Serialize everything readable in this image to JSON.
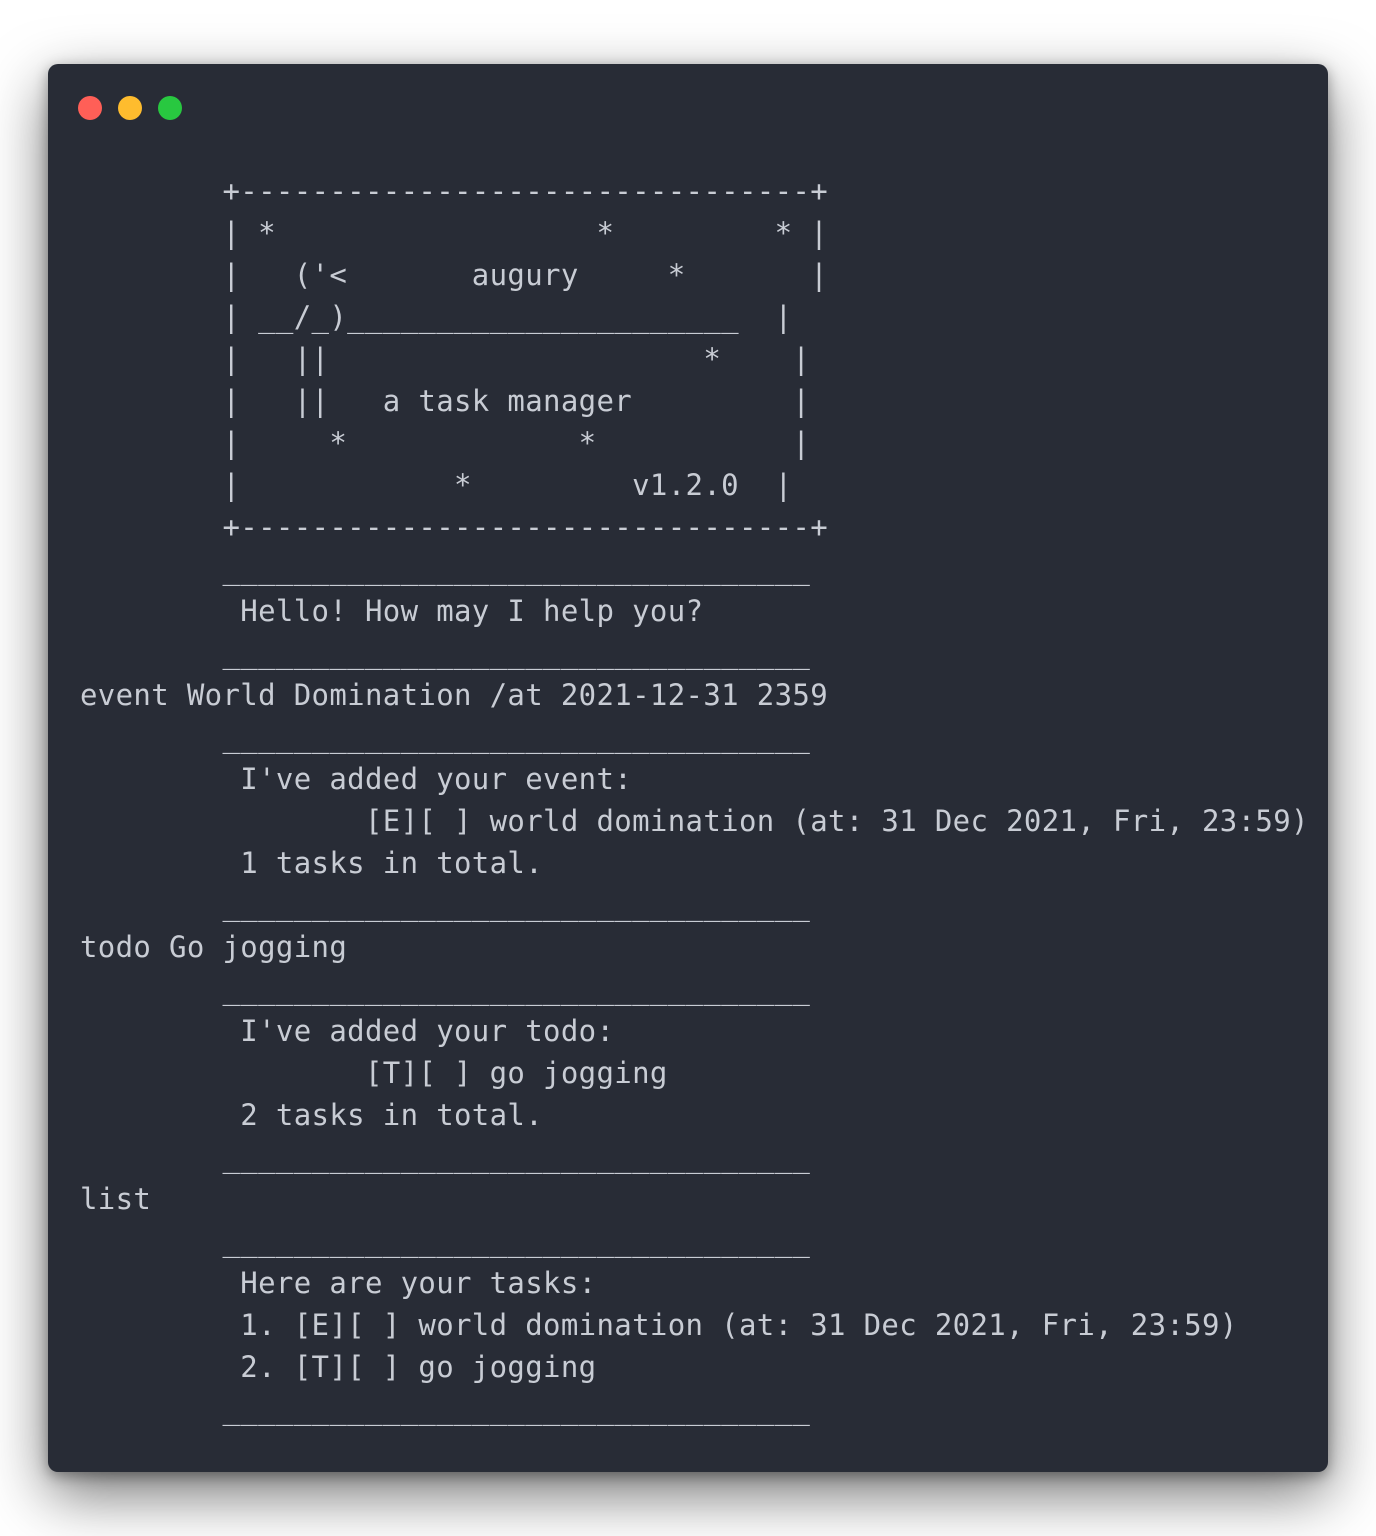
{
  "window": {
    "controls": [
      {
        "name": "close",
        "color": "#ff5f57"
      },
      {
        "name": "minimize",
        "color": "#febc2e"
      },
      {
        "name": "zoom",
        "color": "#28c840"
      }
    ]
  },
  "terminal": {
    "text_color": "#c8ccd4",
    "background": "#282c36",
    "lines": [
      "        +--------------------------------+",
      "        | *                  *         * |",
      "        |   ('<       augury     *       |",
      "        | __/_)______________________  |",
      "        |   ||                     *    |",
      "        |   ||   a task manager         |",
      "        |     *             *           |",
      "        |            *         v1.2.0  |",
      "        +--------------------------------+",
      "        _________________________________",
      "         Hello! How may I help you?",
      "        _________________________________",
      "event World Domination /at 2021-12-31 2359",
      "        _________________________________",
      "         I've added your event:",
      "                [E][ ] world domination (at: 31 Dec 2021, Fri, 23:59)",
      "         1 tasks in total.",
      "        _________________________________",
      "todo Go jogging",
      "        _________________________________",
      "         I've added your todo:",
      "                [T][ ] go jogging",
      "         2 tasks in total.",
      "        _________________________________",
      "list",
      "        _________________________________",
      "         Here are your tasks:",
      "         1. [E][ ] world domination (at: 31 Dec 2021, Fri, 23:59)",
      "         2. [T][ ] go jogging",
      "        _________________________________"
    ]
  }
}
